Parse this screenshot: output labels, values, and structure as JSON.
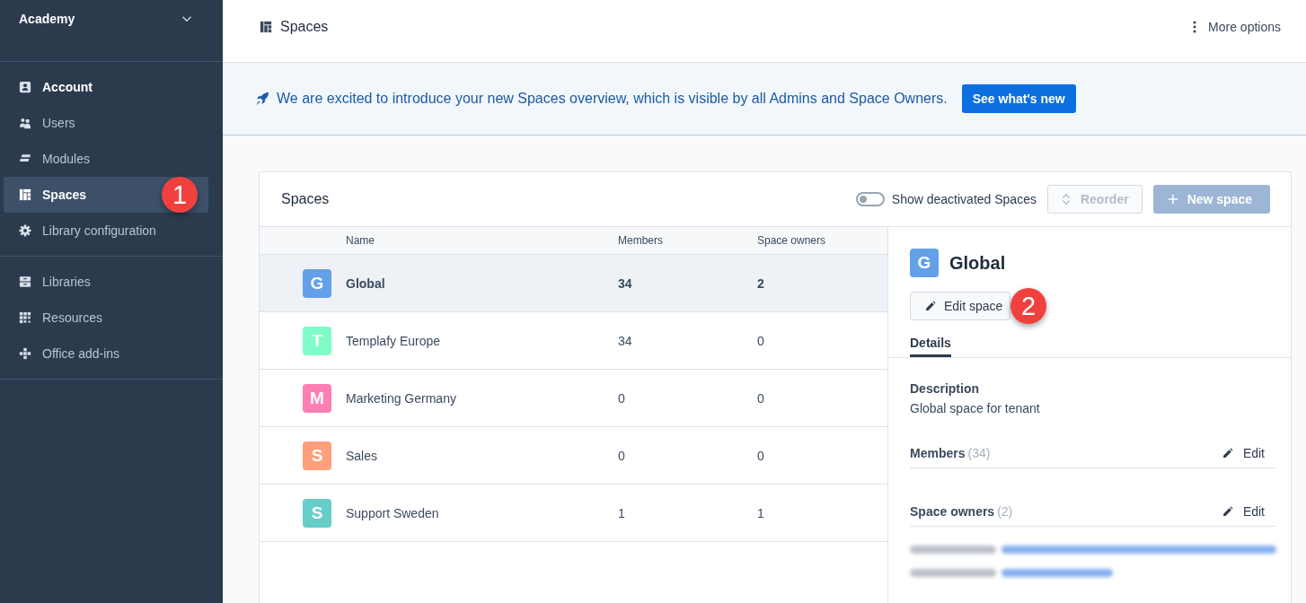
{
  "sidebar": {
    "workspace": "Academy",
    "groups": [
      {
        "items": [
          {
            "label": "Account",
            "kind": "header",
            "selected": false
          },
          {
            "label": "Users",
            "kind": "link",
            "selected": false
          },
          {
            "label": "Modules",
            "kind": "link",
            "selected": false
          },
          {
            "label": "Spaces",
            "kind": "link",
            "selected": true,
            "badge": "1"
          },
          {
            "label": "Library configuration",
            "kind": "link",
            "selected": false
          }
        ]
      },
      {
        "items": [
          {
            "label": "Libraries",
            "kind": "link",
            "selected": false
          },
          {
            "label": "Resources",
            "kind": "link",
            "selected": false
          },
          {
            "label": "Office add-ins",
            "kind": "link",
            "selected": false
          }
        ]
      }
    ]
  },
  "topbar": {
    "title": "Spaces",
    "more": "More options"
  },
  "banner": {
    "message": "We are excited to introduce your new Spaces overview, which is visible by all Admins and Space Owners.",
    "button": "See what's new"
  },
  "panel": {
    "title": "Spaces",
    "toggle": {
      "label": "Show deactivated Spaces",
      "on": false
    },
    "buttons": [
      {
        "label": "Reorder",
        "kind": "secondary",
        "disabled": true
      },
      {
        "label": "New space",
        "kind": "primary",
        "disabled": true
      }
    ]
  },
  "table": {
    "columns": [
      "Name",
      "Members",
      "Space owners"
    ],
    "rows": [
      {
        "initial": "G",
        "color": "#64a0e8",
        "name": "Global",
        "members": "34",
        "owners": "2",
        "selected": true
      },
      {
        "initial": "T",
        "color": "#80fcc8",
        "name": "Templafy Europe",
        "members": "34",
        "owners": "0",
        "selected": false
      },
      {
        "initial": "M",
        "color": "#ff7eb3",
        "name": "Marketing Germany",
        "members": "0",
        "owners": "0",
        "selected": false
      },
      {
        "initial": "S",
        "color": "#ff9f7c",
        "name": "Sales",
        "members": "0",
        "owners": "0",
        "selected": false
      },
      {
        "initial": "S",
        "color": "#66cdc8",
        "name": "Support Sweden",
        "members": "1",
        "owners": "1",
        "selected": false
      }
    ]
  },
  "detail": {
    "initial": "G",
    "name": "Global",
    "edit_button": "Edit space",
    "edit_badge": "2",
    "tabs": [
      {
        "label": "Details",
        "selected": true
      }
    ],
    "description_label": "Description",
    "description": "Global space for tenant",
    "sections": [
      {
        "label": "Members",
        "count": "(34)",
        "action": "Edit"
      },
      {
        "label": "Space owners",
        "count": "(2)",
        "action": "Edit"
      }
    ],
    "owner_entries": [
      {
        "kind": "redacted"
      },
      {
        "kind": "redacted"
      }
    ]
  }
}
